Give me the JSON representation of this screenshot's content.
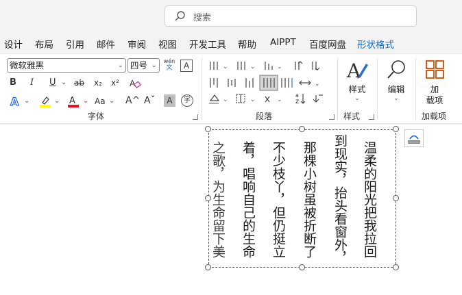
{
  "search": {
    "placeholder": "搜索"
  },
  "tabs": [
    "设计",
    "布局",
    "引用",
    "邮件",
    "审阅",
    "视图",
    "开发工具",
    "帮助",
    "AIPPT",
    "百度网盘",
    "形状格式"
  ],
  "font": {
    "name": "微软雅黑",
    "size": "四号",
    "group_label": "字体",
    "phonetic": "wén",
    "phonetic_char": "文",
    "border_char": "A"
  },
  "paragraph": {
    "group_label": "段落"
  },
  "styles": {
    "button": "样式",
    "group_label": "样式"
  },
  "editing": {
    "button": "编辑"
  },
  "addins": {
    "button_line1": "加",
    "button_line2": "载项",
    "group_label": "加载项"
  },
  "format_buttons": {
    "bold": "B",
    "italic": "I",
    "underline": "U",
    "strike": "ab",
    "sub": "x₂",
    "sup": "x²",
    "aa": "Aa",
    "grow": "A^",
    "shrink": "Aˇ",
    "shade": "A",
    "enclose": "字"
  },
  "document": {
    "columns": [
      "温柔的阳光把我拉回",
      "到现实，抬头看窗外，",
      "那棵小树虽被折断了",
      "不少枝丫，但仍挺立",
      "着，唱响自己的生命",
      "之歌，为生命留下美"
    ]
  },
  "colors": {
    "accent": "#0f6cbd",
    "highlight": "#ffff00",
    "font_color": "#e81123",
    "text_effect": "#2b6fd6",
    "addins_icon": "#d04a02"
  }
}
